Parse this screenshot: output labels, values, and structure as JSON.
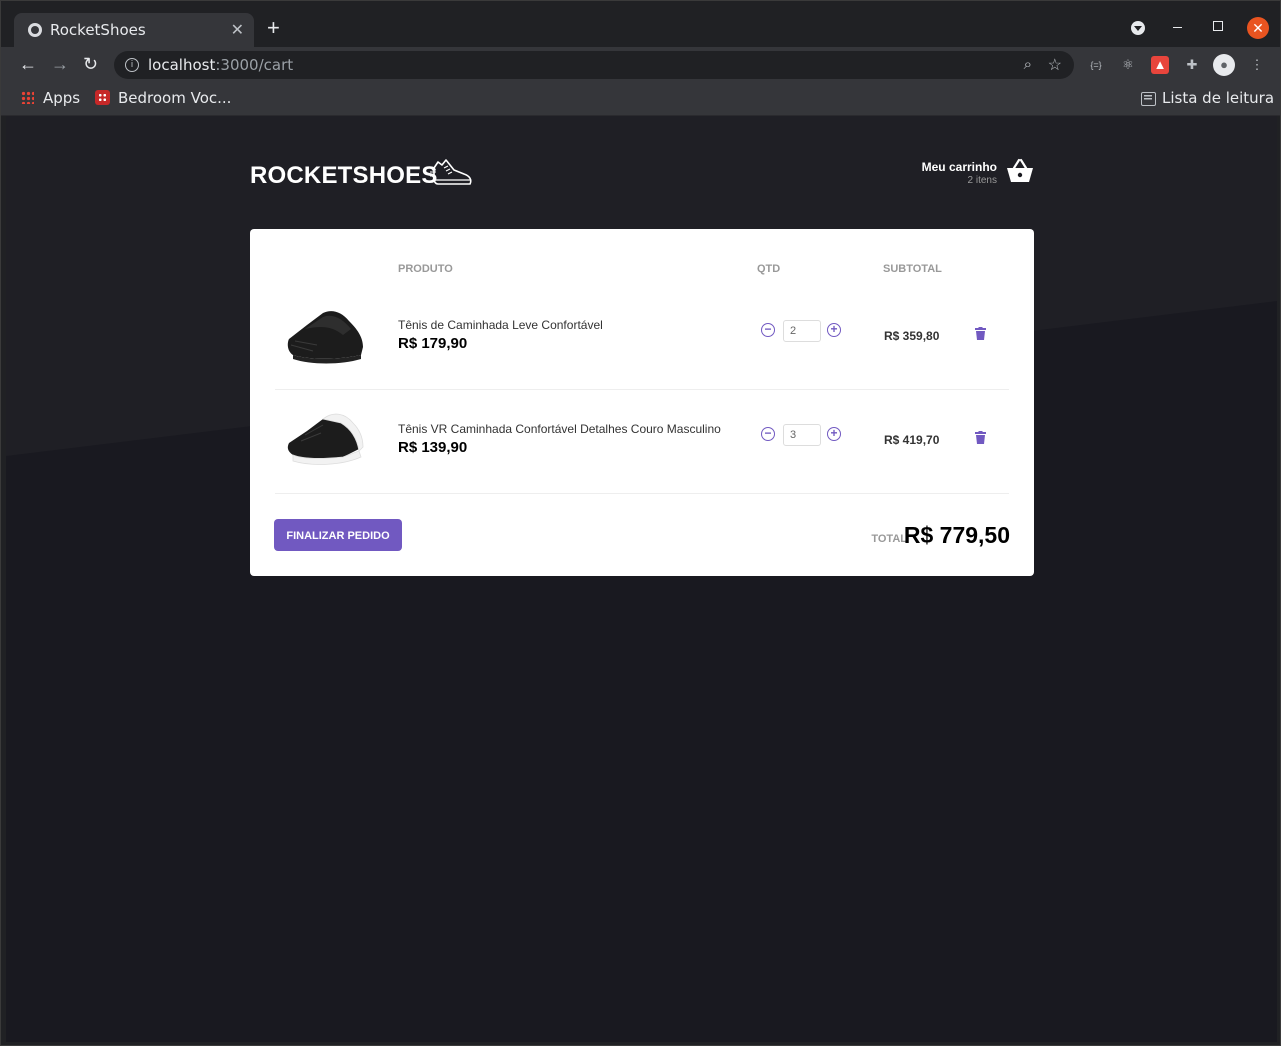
{
  "browser": {
    "tab_title": "RocketShoes",
    "url_host": "localhost",
    "url_path": ":3000/cart",
    "bookmarks": [
      {
        "label": "Apps"
      },
      {
        "label": "Bedroom Voc..."
      }
    ],
    "reading_list": "Lista de leitura"
  },
  "header": {
    "logo": "ROCKETSHOES",
    "cart_title": "Meu carrinho",
    "cart_count": "2 itens"
  },
  "cart": {
    "columns": {
      "product": "PRODUTO",
      "qty": "QTD",
      "subtotal": "SUBTOTAL"
    },
    "items": [
      {
        "name": "Tênis de Caminhada Leve Confortável",
        "price": "R$ 179,90",
        "qty": "2",
        "subtotal": "R$ 359,80",
        "shoe_color": "#1c1c1c",
        "sole_color": "#222222"
      },
      {
        "name": "Tênis VR Caminhada Confortável Detalhes Couro Masculino",
        "price": "R$ 139,90",
        "qty": "3",
        "subtotal": "R$ 419,70",
        "shoe_color": "#1c1c1c",
        "sole_color": "#f2f2f2"
      }
    ],
    "finalize_label": "FINALIZAR PEDIDO",
    "total_label": "TOTAL",
    "total_value": "R$ 779,50"
  },
  "colors": {
    "accent": "#7159c1",
    "background": "#191920"
  }
}
